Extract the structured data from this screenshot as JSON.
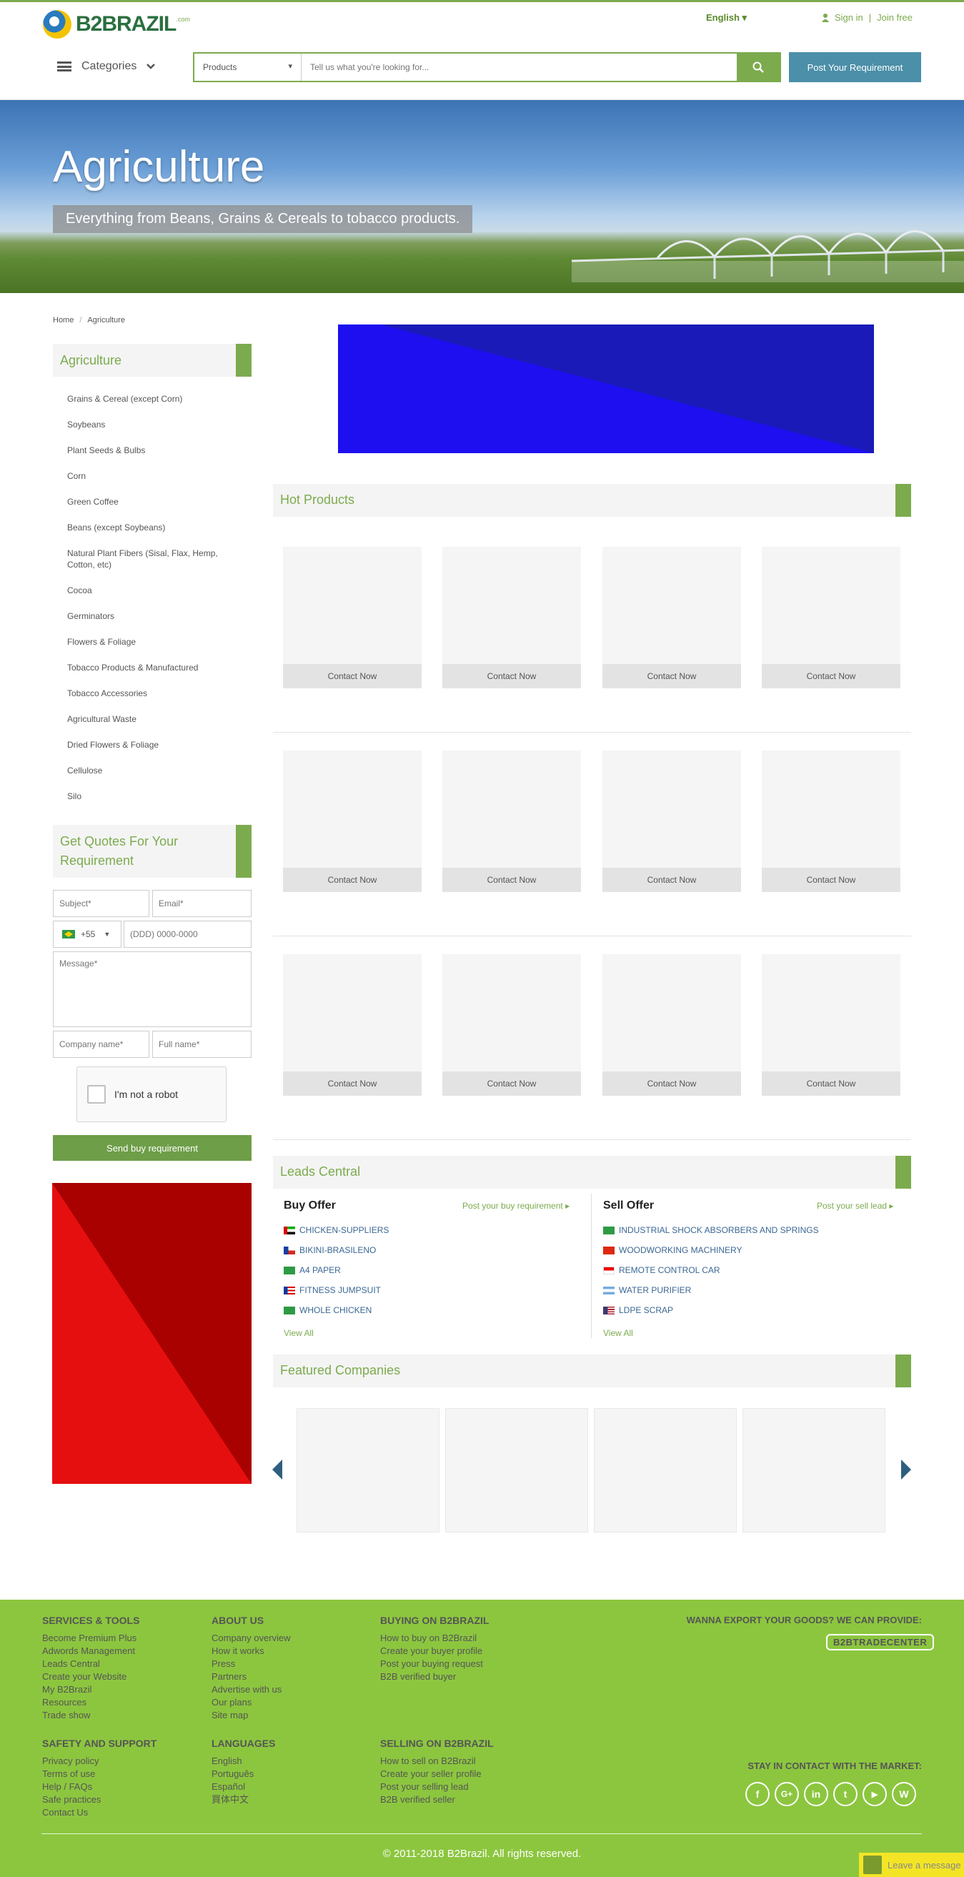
{
  "header": {
    "logo_text": "B2BRAZIL",
    "logo_com": ".com",
    "language": "English ▾",
    "sign_in": "Sign in",
    "separator": "|",
    "join_free": "Join free",
    "categories": "Categories",
    "search_category": "Products",
    "search_placeholder": "Tell us what you're looking for...",
    "post_requirement": "Post Your Requirement"
  },
  "hero": {
    "title": "Agriculture",
    "subtitle": "Everything from Beans, Grains & Cereals to tobacco products."
  },
  "breadcrumb": [
    "Home",
    "/",
    "Agriculture"
  ],
  "sidebar": {
    "heading": "Agriculture",
    "items": [
      "Grains & Cereal (except Corn)",
      "Soybeans",
      "Plant Seeds & Bulbs",
      "Corn",
      "Green Coffee",
      "Beans (except Soybeans)",
      "Natural Plant Fibers (Sisal, Flax, Hemp, Cotton, etc)",
      "Cocoa",
      "Germinators",
      "Flowers & Foliage",
      "Tobacco Products & Manufactured",
      "Tobacco Accessories",
      "Agricultural Waste",
      "Dried Flowers & Foliage",
      "Cellulose",
      "Silo"
    ]
  },
  "quote_form": {
    "heading": "Get Quotes For Your Requirement",
    "subject_placeholder": "Subject*",
    "email_placeholder": "Email*",
    "phone_code": "+55",
    "phone_placeholder": "(DDD) 0000-0000",
    "message_placeholder": "Message*",
    "company_placeholder": "Company name*",
    "fullname_placeholder": "Full name*",
    "captcha_label": "I'm not a robot",
    "send_label": "Send buy requirement"
  },
  "hot_products": {
    "heading": "Hot Products",
    "contact_label": "Contact Now"
  },
  "leads": {
    "heading": "Leads Central",
    "buy": {
      "title": "Buy Offer",
      "post_link": "Post your buy requirement ▸",
      "items": [
        {
          "label": "CHICKEN-SUPPLIERS",
          "flag": "ae"
        },
        {
          "label": "BIKINI-BRASILENO",
          "flag": "cl"
        },
        {
          "label": "A4 PAPER",
          "flag": "br"
        },
        {
          "label": "FITNESS JUMPSUIT",
          "flag": "pr"
        },
        {
          "label": "WHOLE CHICKEN",
          "flag": "br"
        }
      ],
      "view_all": "View All"
    },
    "sell": {
      "title": "Sell Offer",
      "post_link": "Post your sell lead ▸",
      "items": [
        {
          "label": "INDUSTRIAL SHOCK ABSORBERS AND SPRINGS",
          "flag": "br"
        },
        {
          "label": "WOODWORKING MACHINERY",
          "flag": "cn"
        },
        {
          "label": "REMOTE CONTROL CAR",
          "flag": "id"
        },
        {
          "label": "WATER PURIFIER",
          "flag": "ar"
        },
        {
          "label": "LDPE SCRAP",
          "flag": "us"
        }
      ],
      "view_all": "View All"
    }
  },
  "featured": {
    "heading": "Featured Companies"
  },
  "footer": {
    "services": {
      "title": "SERVICES & TOOLS",
      "links": [
        "Become Premium Plus",
        "Adwords Management",
        "Leads Central",
        "Create your Website",
        "My B2Brazil",
        "Resources",
        "Trade show"
      ]
    },
    "about": {
      "title": "ABOUT US",
      "links": [
        "Company overview",
        "How it works",
        "Press",
        "Partners",
        "Advertise with us",
        "Our plans",
        "Site map"
      ]
    },
    "buying": {
      "title": "BUYING ON B2BRAZIL",
      "links": [
        "How to buy on B2Brazil",
        "Create your buyer profile",
        "Post your buying request",
        "B2B verified buyer"
      ]
    },
    "safety": {
      "title": "SAFETY AND SUPPORT",
      "links": [
        "Privacy policy",
        "Terms of use",
        "Help / FAQs",
        "Safe practices",
        "Contact Us"
      ]
    },
    "languages": {
      "title": "LANGUAGES",
      "links": [
        "English",
        "Português",
        "Español",
        "買体中文"
      ]
    },
    "selling": {
      "title": "SELLING ON B2BRAZIL",
      "links": [
        "How to sell on B2Brazil",
        "Create your seller profile",
        "Post your selling lead",
        "B2B verified seller"
      ]
    },
    "export_title": "WANNA EXPORT YOUR GOODS? WE CAN PROVIDE:",
    "trade_center": "B2BTRADECENTER",
    "stay_title": "STAY IN CONTACT WITH THE MARKET:",
    "social": [
      "f",
      "G+",
      "in",
      "t",
      "▶",
      "W"
    ],
    "copyright": "© 2011-2018 B2Brazil. All rights reserved.",
    "leave_message": "Leave a message"
  },
  "colors": {
    "brand_green": "#7cab4e",
    "footer_green": "#8cc63f",
    "post_button": "#4b8fa8",
    "link_blue": "#3a6793"
  }
}
